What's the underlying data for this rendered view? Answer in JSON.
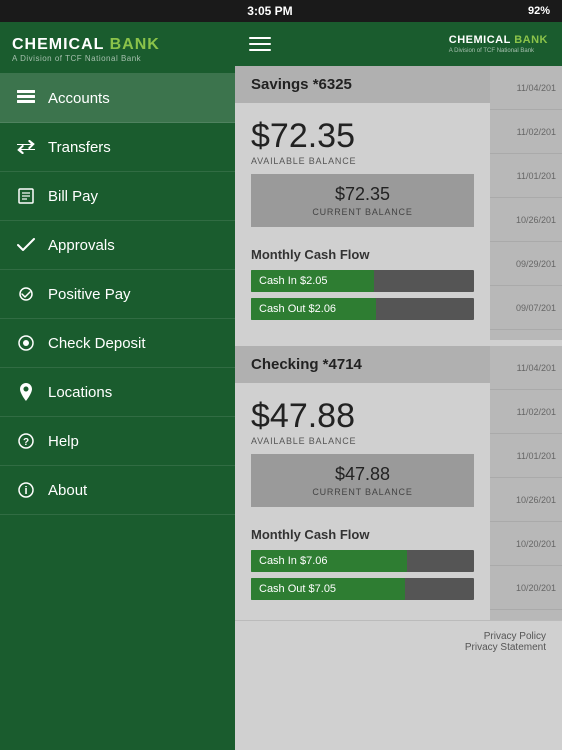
{
  "statusBar": {
    "time": "3:05 PM",
    "battery": "92%",
    "batterySymbol": "▮"
  },
  "sidebar": {
    "logo": {
      "line1": "CHEMICAL",
      "line1accent": "BANK",
      "line2": "A Division of TCF National Bank"
    },
    "items": [
      {
        "id": "accounts",
        "label": "Accounts",
        "icon": "≡",
        "active": true
      },
      {
        "id": "transfers",
        "label": "Transfers",
        "icon": "⇄"
      },
      {
        "id": "billpay",
        "label": "Bill Pay",
        "icon": "☰"
      },
      {
        "id": "approvals",
        "label": "Approvals",
        "icon": "✓"
      },
      {
        "id": "positivepay",
        "label": "Positive Pay",
        "icon": "✓"
      },
      {
        "id": "checkdeposit",
        "label": "Check Deposit",
        "icon": "⊙"
      },
      {
        "id": "locations",
        "label": "Locations",
        "icon": "⌂"
      },
      {
        "id": "help",
        "label": "Help",
        "icon": "?"
      },
      {
        "id": "about",
        "label": "About",
        "icon": "ℹ"
      }
    ]
  },
  "topBar": {
    "logoLine1": "CHEMICAL BANK",
    "logoLine2": "A Division of TCF National Bank"
  },
  "accounts": [
    {
      "id": "savings",
      "name": "Savings *6325",
      "availableBalance": "$72.35",
      "availableLabel": "AVAILABLE BALANCE",
      "currentBalance": "$72.35",
      "currentLabel": "CURRENT BALANCE",
      "cashFlow": {
        "title": "Monthly Cash Flow",
        "cashIn": {
          "label": "Cash In $2.05",
          "percent": 55
        },
        "cashOut": {
          "label": "Cash Out $2.06",
          "percent": 56
        }
      },
      "dates": [
        "11/04/201",
        "11/02/201",
        "11/01/201",
        "10/26/201",
        "09/29/201",
        "09/07/201"
      ]
    },
    {
      "id": "checking",
      "name": "Checking *4714",
      "availableBalance": "$47.88",
      "availableLabel": "AVAILABLE BALANCE",
      "currentBalance": "$47.88",
      "currentLabel": "CURRENT BALANCE",
      "cashFlow": {
        "title": "Monthly Cash Flow",
        "cashIn": {
          "label": "Cash In $7.06",
          "percent": 70
        },
        "cashOut": {
          "label": "Cash Out $7.05",
          "percent": 69
        }
      },
      "dates": [
        "11/04/201",
        "11/02/201",
        "11/01/201",
        "10/26/201",
        "10/20/201",
        "10/20/201"
      ]
    }
  ],
  "footer": {
    "privacyPolicy": "Privacy Policy",
    "privacyStatement": "Privacy Statement"
  }
}
